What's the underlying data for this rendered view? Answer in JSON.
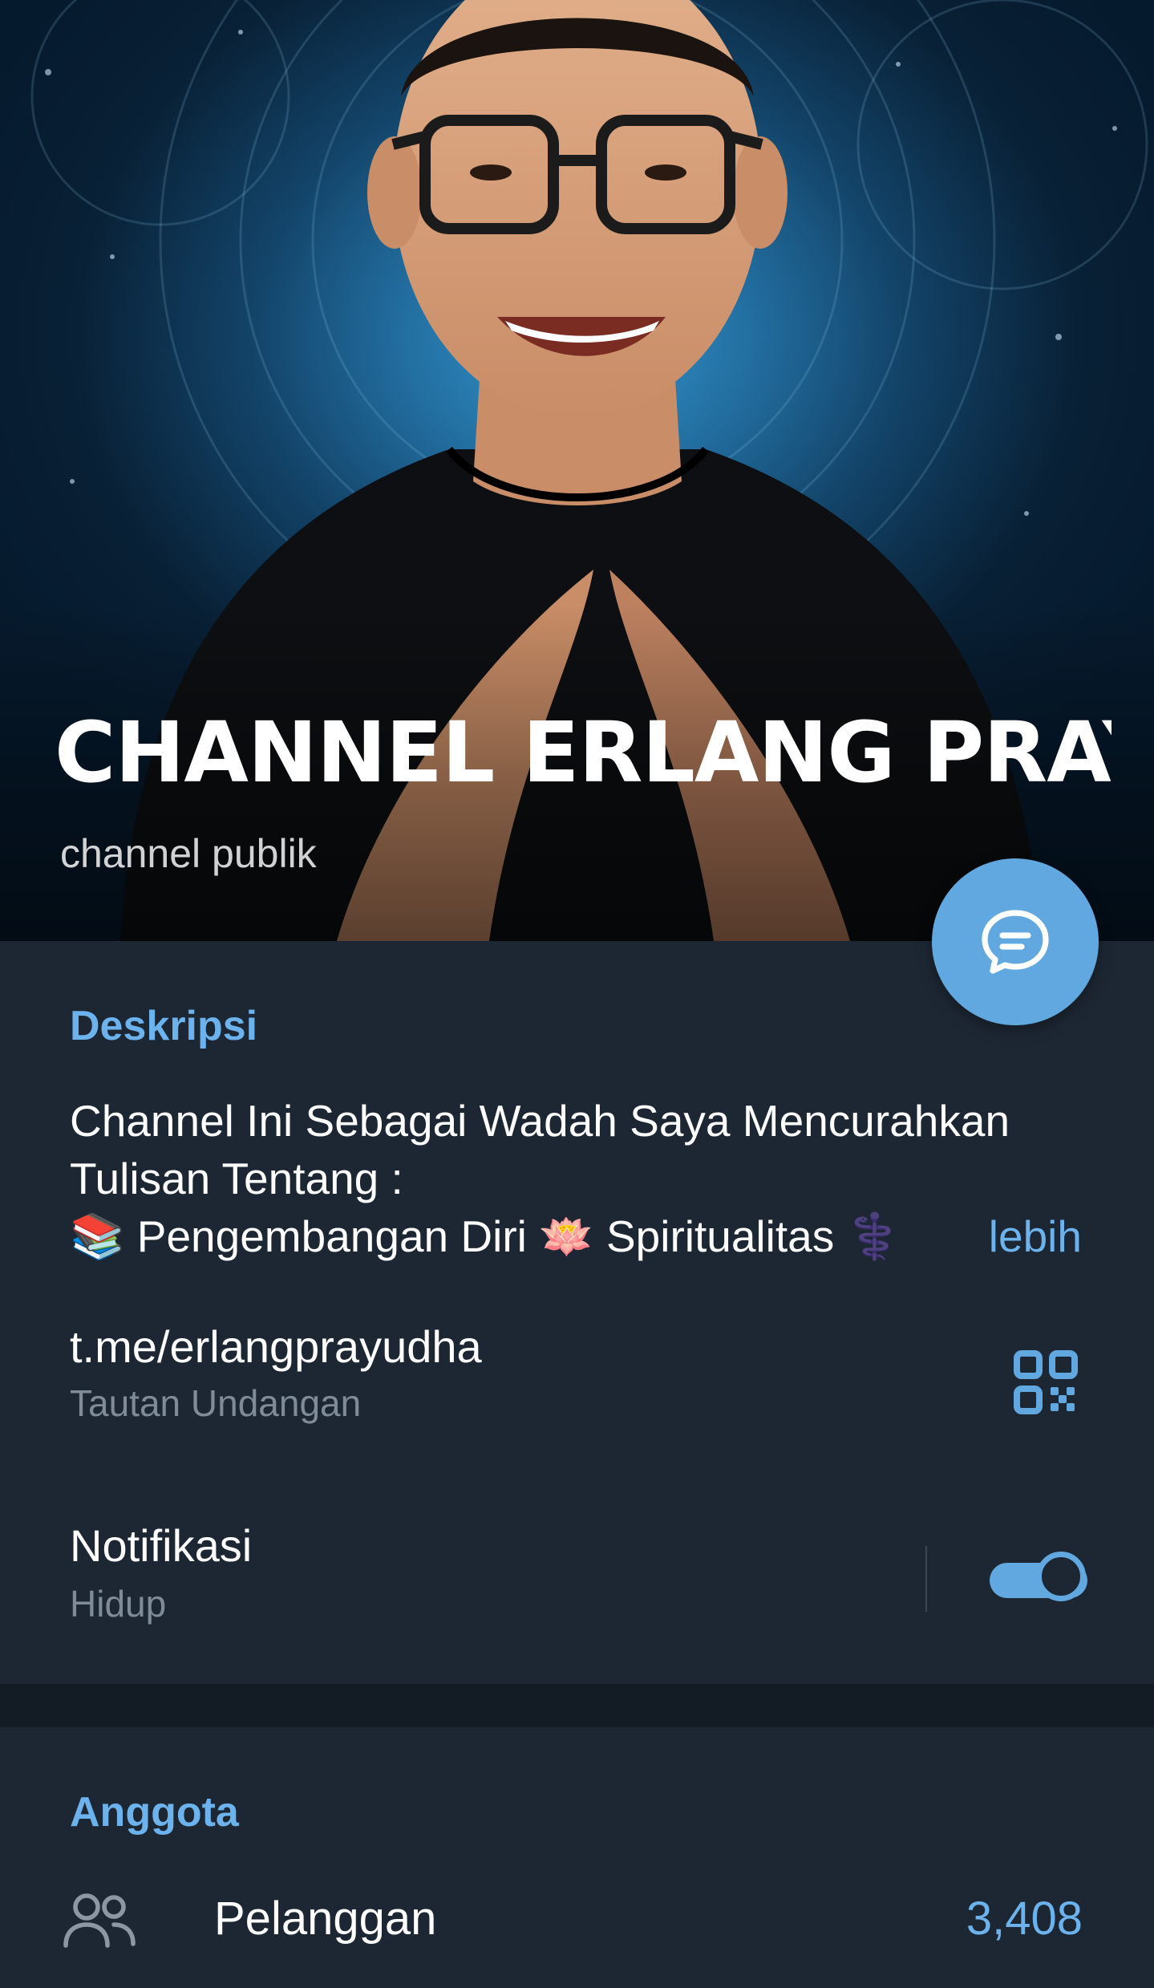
{
  "header": {
    "title": "CHANNEL ERLANG PRAYUDHA",
    "subtitle": "channel publik"
  },
  "description": {
    "heading": "Deskripsi",
    "lines": [
      "Channel Ini Sebagai Wadah Saya Mencurahkan",
      "Tulisan Tentang :"
    ],
    "line3_parts": [
      "📚",
      " Pengembangan Diri ",
      "🪷",
      " Spiritualitas ",
      "⚕️"
    ],
    "more": "lebih"
  },
  "link": {
    "value": "t.me/erlangprayudha",
    "label": "Tautan Undangan"
  },
  "notifications": {
    "title": "Notifikasi",
    "status": "Hidup",
    "enabled": true
  },
  "members": {
    "heading": "Anggota",
    "label": "Pelanggan",
    "count": "3,408"
  },
  "icons": {
    "fab": "chat-bubble-icon",
    "link": "qr-code-icon",
    "members": "people-icon"
  },
  "colors": {
    "accent": "#62a8e0",
    "link_text": "#6cb3ee",
    "background": "#1d2733",
    "separator_band": "#131b24",
    "secondary_text": "#7f8b98"
  }
}
